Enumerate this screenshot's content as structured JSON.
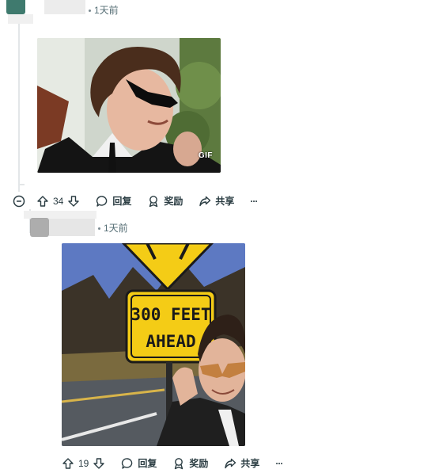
{
  "comment1": {
    "time": "1天前",
    "gif_badge": "GIF",
    "actions": {
      "upvotes": "34",
      "reply": "回复",
      "award": "奖励",
      "share": "共享",
      "more": "···"
    }
  },
  "comment2": {
    "time": "1天前",
    "sign_line1": "300 FEET",
    "sign_line2": "AHEAD",
    "actions": {
      "upvotes": "19",
      "reply": "回复",
      "award": "奖励",
      "share": "共享",
      "more": "···"
    }
  },
  "icons": [
    "collapse-icon",
    "upvote-icon",
    "downvote-icon",
    "reply-icon",
    "award-icon",
    "share-icon",
    "more-icon"
  ],
  "colors": {
    "text": "#2a3c42",
    "meta": "#576f76",
    "thread_line": "#e3e6e8",
    "sign_yellow": "#f4cc16"
  }
}
